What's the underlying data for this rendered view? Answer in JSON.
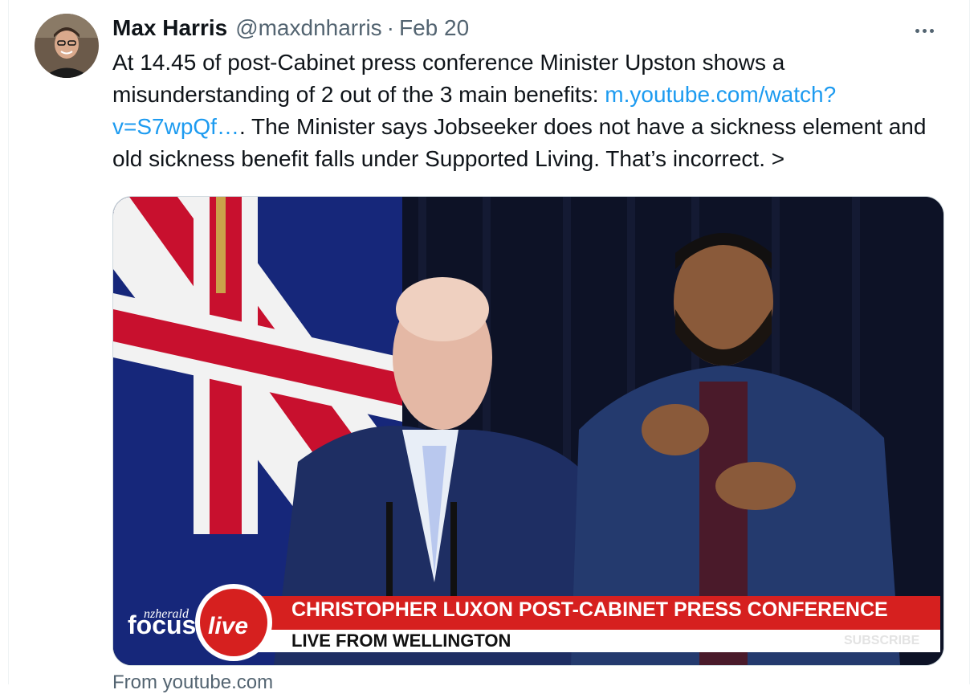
{
  "tweet": {
    "author_name": "Max Harris",
    "handle": "@maxdnharris",
    "separator": "·",
    "date": "Feb 20",
    "text_part1": "At 14.45 of post-Cabinet press conference Minister Upston shows a misunderstanding of 2 out of the 3 main benefits: ",
    "link_text": "m.youtube.com/watch?v=S7wpQf…",
    "text_part2": ". The Minister says Jobseeker does not have a sickness element and old sickness benefit falls under Supported Living. That’s incorrect. >",
    "more_icon": "more-horizontal-icon",
    "link_color": "#1d9bf0"
  },
  "media": {
    "brand_small": "nzherald",
    "brand_focus": "focus",
    "brand_live": "live",
    "headline": "CHRISTOPHER LUXON POST-CABINET PRESS CONFERENCE",
    "subheadline": "LIVE FROM WELLINGTON",
    "subscribe": "SUBSCRIBE",
    "banner_red": "#d6201f"
  },
  "card_source": "From youtube.com"
}
